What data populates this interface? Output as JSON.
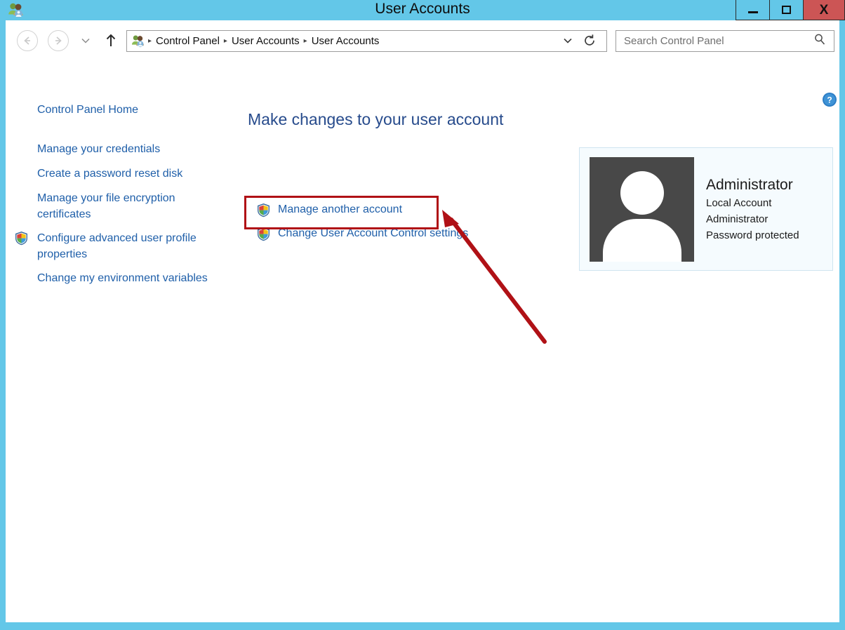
{
  "window": {
    "title": "User Accounts",
    "icon": "user-accounts-icon",
    "minimize_label": "–",
    "maximize_label": "□",
    "close_label": "X",
    "frame_color": "#63c7e8",
    "close_color": "#cc5555"
  },
  "toolbar": {
    "back_label": "Back",
    "forward_label": "Forward",
    "recent_label": "Recent locations",
    "up_label": "Up one level",
    "address": {
      "icon": "user-accounts-icon",
      "crumbs": [
        "Control Panel",
        "User Accounts",
        "User Accounts"
      ],
      "separator": "▸",
      "dropdown_label": "⌄",
      "refresh_label": "↻"
    },
    "search": {
      "placeholder": "Search Control Panel",
      "icon": "search-icon"
    }
  },
  "help": {
    "label": "?",
    "name": "help-button",
    "color": "#2b7cc4"
  },
  "sidebar": {
    "home_label": "Control Panel Home",
    "items": [
      {
        "label": "Manage your credentials",
        "shield": false
      },
      {
        "label": "Create a password reset disk",
        "shield": false
      },
      {
        "label": "Manage your file encryption certificates",
        "shield": false
      },
      {
        "label": "Configure advanced user profile properties",
        "shield": true
      },
      {
        "label": "Change my environment variables",
        "shield": false
      }
    ]
  },
  "main": {
    "heading": "Make changes to your user account",
    "tasks": [
      {
        "label": "Manage another account",
        "shield": true,
        "highlighted": true
      },
      {
        "label": "Change User Account Control settings",
        "shield": true,
        "highlighted": false
      }
    ],
    "highlight_color": "#b01116"
  },
  "account": {
    "name": "Administrator",
    "lines": [
      "Local Account",
      "Administrator",
      "Password protected"
    ],
    "avatar": "user-avatar-icon",
    "panel_color": "#f5fbfe",
    "panel_border": "#cfe4f0"
  },
  "annotation": {
    "arrow_color": "#b01116",
    "type": "arrow-pointing-to-manage-another-account"
  }
}
